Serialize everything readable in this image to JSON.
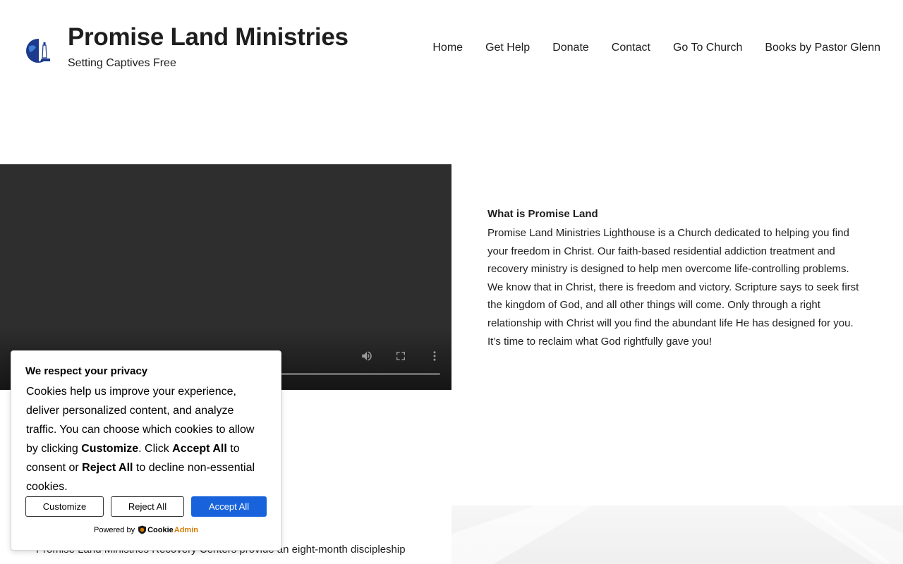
{
  "header": {
    "title": "Promise Land Ministries",
    "tagline": "Setting Captives Free",
    "logo_icon": "globe-lighthouse-logo"
  },
  "nav": {
    "items": [
      {
        "label": "Home"
      },
      {
        "label": "Get Help"
      },
      {
        "label": "Donate"
      },
      {
        "label": "Contact"
      },
      {
        "label": "Go To Church"
      },
      {
        "label": "Books by Pastor Glenn"
      }
    ]
  },
  "video": {
    "controls": [
      "volume-icon",
      "fullscreen-icon",
      "more-options-icon"
    ]
  },
  "about": {
    "heading": "What is Promise Land",
    "body": "Promise Land Ministries Lighthouse is a Church dedicated to helping you find your freedom in Christ. Our faith-based residential addiction treatment and recovery ministry is designed to help men overcome life-controlling problems. We know that in Christ, there is freedom and victory. Scripture says to seek first the kingdom of God, and all other things will come. Only through a right relationship with Christ will you find the abundant life He has designed for you. It’s time to reclaim what God rightfully gave you!"
  },
  "recovery": {
    "text": "Promise Land Ministries Recovery Centers provide an eight-month discipleship"
  },
  "cookie": {
    "title": "We respect your privacy",
    "text_1": "Cookies help us improve your experience, deliver personalized content, and analyze traffic. You can choose which cookies to allow by clicking ",
    "bold_customize": "Customize",
    "text_2": ". Click ",
    "bold_accept": "Accept All",
    "text_3": " to consent or ",
    "bold_reject": "Reject All",
    "text_4": " to decline non-essential cookies.",
    "customize_label": "Customize",
    "reject_label": "Reject All",
    "accept_label": "Accept All",
    "powered_by": "Powered by",
    "brand_part1": "Cookie",
    "brand_part2": "Admin",
    "colors": {
      "accept_bg": "#1863dc",
      "brand_accent": "#d97a00"
    }
  }
}
